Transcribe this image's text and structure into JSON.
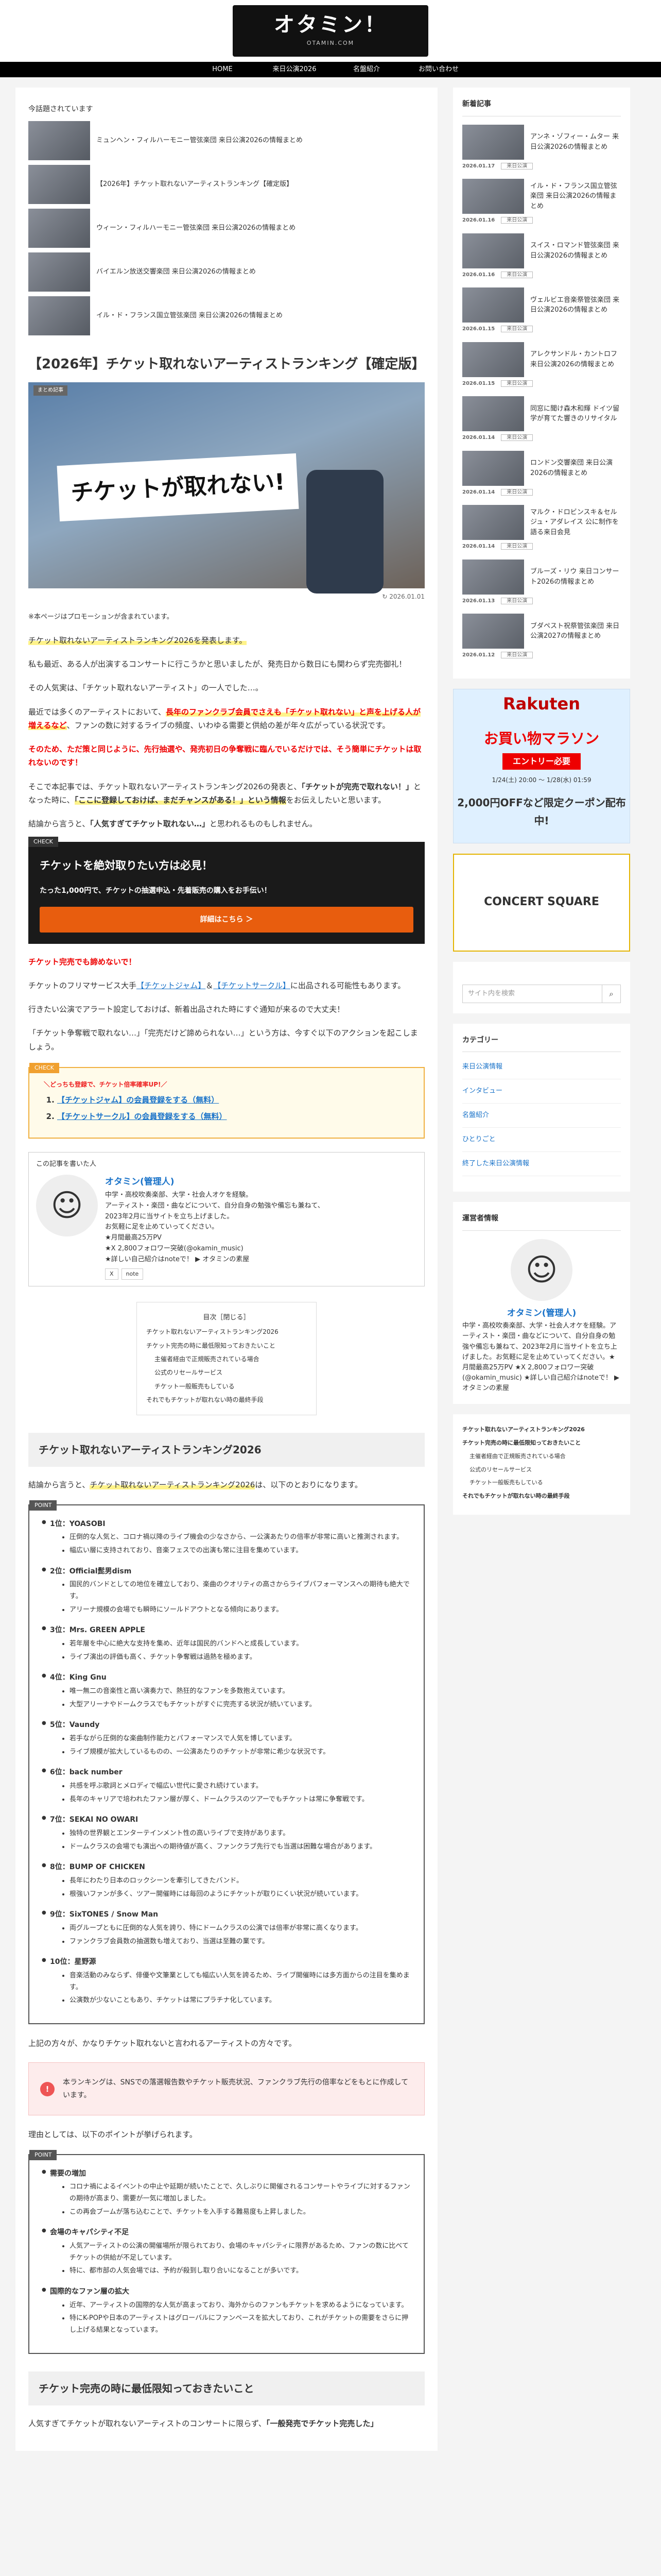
{
  "header": {
    "logo_title": "オタミン！",
    "logo_subtitle": "OTAMIN.COM"
  },
  "nav": [
    "HOME",
    "来日公演2026",
    "名盤紹介",
    "お問い合わせ"
  ],
  "recommend": {
    "label": "今話題されています",
    "items": [
      "ミュンヘン・フィルハーモニー管弦楽団 来日公演2026の情報まとめ",
      "【2026年】チケット取れないアーティストランキング【確定版】",
      "ウィーン・フィルハーモニー管弦楽団 来日公演2026の情報まとめ",
      "バイエルン放送交響楽団 来日公演2026の情報まとめ",
      "イル・ド・フランス国立管弦楽団 来日公演2026の情報まとめ"
    ]
  },
  "article": {
    "title": "【2026年】チケット取れないアーティストランキング【確定版】",
    "eyecatch_category": "まとめ記事",
    "eyecatch_text": "チケットが取れない!",
    "date": "2026.01.01",
    "pr_note": "※本ページはプロモーションが含まれています。",
    "p1": "チケット取れないアーティストランキング2026を発表します。",
    "p2": "私も最近、ある人が出演するコンサートに行こうかと思いましたが、発売日から数日にも関わらず完売御礼！",
    "p3": "その人気実は、「チケット取れないアーティスト」の一人でした…。",
    "p4a": "最近では多くのアーティストにおいて、",
    "p4b": "長年のファンクラブ会員でさえも「チケット取れない」と声を上げる人が増えるなど",
    "p4c": "、ファンの数に対するライブの頻度、いわゆる需要と供給の差が年々広がっている状況です。",
    "p5": "そのため、ただ策と同じように、先行抽選や、発売初日の争奪戦に臨んでいるだけでは、そう簡単にチケットは取れないのです！",
    "p6a": "そこで本記事では、チケット取れないアーティストランキング2026の発表と、",
    "p6b": "「チケットが完売で取れない！」",
    "p6c": "となった時に、",
    "p6d": "「ここに登録しておけば、まだチャンスがある！」という情報",
    "p6e": "をお伝えしたいと思います。",
    "p7a": "結論から言うと、",
    "p7b": "「人気すぎてチケット取れない…」",
    "p7c": "と思われるものもしれません。"
  },
  "cta": {
    "tag": "CHECK",
    "title": "チケットを絶対取りたい方は必見！",
    "sub": "たった1,000円で、チケットの抽選申込・先着販売の購入をお手伝い！",
    "button": "詳細はこちら ＞"
  },
  "p8": "チケット完売でも諦めないで！",
  "p9a": "チケットのフリマサービス大手",
  "p9b": "【チケットジャム】",
  "p9c": "＆",
  "p9d": "【チケットサークル】",
  "p9e": "に出品される可能性もあります。",
  "p10": "行きたい公演でアラート設定しておけば、新着出品された時にすぐ通知が来るので大丈夫！",
  "p11": "「チケット争奪戦で取れない…」「完売だけど諦められない…」という方は、今すぐ以下のアクションを起こしましょう。",
  "check": {
    "tag": "CHECK",
    "head": "＼どっちも登録で、チケット倍率確率UP!／",
    "items": [
      "【チケットジャム】の会員登録をする（無料）",
      "【チケットサークル】の会員登録をする（無料）"
    ]
  },
  "author": {
    "label": "この記事を書いた人",
    "name": "オタミン(管理人)",
    "lines": [
      "中学・高校吹奏楽部、大学・社会人オケを経験。",
      "アーティスト・楽団・曲などについて、自分自身の勉強や備忘も兼ねて、",
      "2023年2月に当サイトを立ち上げました。",
      "お気軽に足を止めていってください。",
      "★月間最高25万PV",
      "★X 2,800フォロワー突破(@okamin_music)",
      "★詳しい自己紹介はnoteで！ ▶ オタミンの素屋"
    ],
    "social": [
      "X",
      "note"
    ]
  },
  "toc": {
    "head": "目次［閉じる］",
    "items": [
      {
        "t": "チケット取れないアーティストランキング2026",
        "sub": false
      },
      {
        "t": "チケット完売の時に最低限知っておきたいこと",
        "sub": false
      },
      {
        "t": "主催者経由で正規販売されている場合",
        "sub": true
      },
      {
        "t": "公式のリセールサービス",
        "sub": true
      },
      {
        "t": "チケット一般販売もしている",
        "sub": true
      },
      {
        "t": "それでもチケットが取れない時の最終手段",
        "sub": false
      }
    ]
  },
  "h2_ranking": "チケット取れないアーティストランキング2026",
  "rank_intro_a": "結論から言うと、",
  "rank_intro_b": "チケット取れないアーティストランキング2026",
  "rank_intro_c": "は、以下のとおりになります。",
  "ranking": {
    "tag": "POINT",
    "items": [
      {
        "t": "1位：YOASOBI",
        "b": [
          "圧倒的な人気と、コロナ禍以降のライブ機会の少なさから、一公演あたりの倍率が非常に高いと推測されます。",
          "幅広い層に支持されており、音楽フェスでの出演も常に注目を集めています。"
        ]
      },
      {
        "t": "2位：Official髭男dism",
        "b": [
          "国民的バンドとしての地位を確立しており、楽曲のクオリティの高さからライブパフォーマンスへの期待も絶大です。",
          "アリーナ規模の会場でも瞬時にソールドアウトとなる傾向にあります。"
        ]
      },
      {
        "t": "3位：Mrs. GREEN APPLE",
        "b": [
          "若年層を中心に絶大な支持を集め、近年は国民的バンドへと成長しています。",
          "ライブ演出の評価も高く、チケット争奪戦は過熱を極めます。"
        ]
      },
      {
        "t": "4位：King Gnu",
        "b": [
          "唯一無二の音楽性と高い演奏力で、熱狂的なファンを多数抱えています。",
          "大型アリーナやドームクラスでもチケットがすぐに完売する状況が続いています。"
        ]
      },
      {
        "t": "5位：Vaundy",
        "b": [
          "若手ながら圧倒的な楽曲制作能力とパフォーマンスで人気を博しています。",
          "ライブ規模が拡大しているものの、一公演あたりのチケットが非常に希少な状況です。"
        ]
      },
      {
        "t": "6位：back number",
        "b": [
          "共感を呼ぶ歌詞とメロディで幅広い世代に愛され続けています。",
          "長年のキャリアで培われたファン層が厚く、ドームクラスのツアーでもチケットは常に争奪戦です。"
        ]
      },
      {
        "t": "7位：SEKAI NO OWARI",
        "b": [
          "独特の世界観とエンターテインメント性の高いライブで支持があります。",
          "ドームクラスの会場でも演出への期待値が高く、ファンクラブ先行でも当選は困難な場合があります。"
        ]
      },
      {
        "t": "8位：BUMP OF CHICKEN",
        "b": [
          "長年にわたり日本のロックシーンを牽引してきたバンド。",
          "根強いファンが多く、ツアー開催時には毎回のようにチケットが取りにくい状況が続いています。"
        ]
      },
      {
        "t": "9位：SixTONES / Snow Man",
        "b": [
          "両グループともに圧倒的な人気を誇り、特にドームクラスの公演では倍率が非常に高くなります。",
          "ファンクラブ会員数の抽選数も増えており、当選は至難の業です。"
        ]
      },
      {
        "t": "10位：星野源",
        "b": [
          "音楽活動のみならず、俳優や文筆業としても幅広い人気を誇るため、ライブ開催時には多方面からの注目を集めます。",
          "公演数が少ないこともあり、チケットは常にプラチナ化しています。"
        ]
      }
    ]
  },
  "after_rank": "上記の方々が、かなりチケット取れないと言われるアーティストの方々です。",
  "warn": "本ランキングは、SNSでの落選報告数やチケット販売状況、ファンクラブ先行の倍率などをもとに作成しています。",
  "reason_intro": "理由としては、以下のポイントが挙げられます。",
  "points": {
    "tag": "POINT",
    "items": [
      {
        "t": "需要の増加",
        "b": [
          "コロナ禍によるイベントの中止や延期が続いたことで、久しぶりに開催されるコンサートやライブに対するファンの期待が高まり、需要が一気に増加しました。",
          "この再会ブームが落ち込むことで、チケットを入手する難易度も上昇しました。"
        ]
      },
      {
        "t": "会場のキャパシティ不足",
        "b": [
          "人気アーティストの公演の開催場所が限られており、会場のキャパシティに限界があるため、ファンの数に比べてチケットの供給が不足しています。",
          "特に、都市部の人気会場では、予約が殺到し取り合いになることが多いです。"
        ]
      },
      {
        "t": "国際的なファン層の拡大",
        "b": [
          "近年、アーティストの国際的な人気が高まっており、海外からのファンもチケットを求めるようになっています。",
          "特にK-POPや日本のアーティストはグローバルにファンベースを拡大しており、これがチケットの需要をさらに押し上げる結果となっています。"
        ]
      }
    ]
  },
  "h2_tips": "チケット完売の時に最低限知っておきたいこと",
  "last_a": "人気すぎてチケットが取れないアーティストのコンサートに限らず、",
  "last_b": "「一般発売でチケット完売した」",
  "sidebar": {
    "new_head": "新着記事",
    "new_label": "来日公演",
    "new_items": [
      {
        "t": "アンネ・ゾフィー・ムター 来日公演2026の情報まとめ",
        "d": "2026.01.17"
      },
      {
        "t": "イル・ド・フランス国立管弦楽団 来日公演2026の情報まとめ",
        "d": "2026.01.16"
      },
      {
        "t": "スイス・ロマンド管弦楽団 来日公演2026の情報まとめ",
        "d": "2026.01.16"
      },
      {
        "t": "ヴェルビエ音楽祭管弦楽団 来日公演2026の情報まとめ",
        "d": "2026.01.15"
      },
      {
        "t": "アレクサンドル・カントロフ 来日公演2026の情報まとめ",
        "d": "2026.01.15"
      },
      {
        "t": "同窓に聞け森木和輝 ドイツ留学が育てた響きのリサイタル",
        "d": "2026.01.14"
      },
      {
        "t": "ロンドン交響楽団 来日公演2026の情報まとめ",
        "d": "2026.01.14"
      },
      {
        "t": "マルク・ドロビンスキ＆セルジュ・アダレイス 公に制作を語る来日会見",
        "d": "2026.01.14"
      },
      {
        "t": "ブルーズ・リウ 来日コンサート2026の情報まとめ",
        "d": "2026.01.13"
      },
      {
        "t": "ブダペスト祝祭管弦楽団 来日公演2027の情報まとめ",
        "d": "2026.01.12"
      }
    ],
    "ad_rakuten": {
      "brand": "Rakuten",
      "main": "お買い物マラソン",
      "btn": "エントリー必要",
      "date": "1/24(土) 20:00 ～ 1/28(水) 01:59",
      "extra": "2,000円OFFなど限定クーポン配布中!"
    },
    "ad_concert": "CONCERT SQUARE",
    "search_placeholder": "サイト内を検索",
    "cat_head": "カテゴリー",
    "cats": [
      {
        "n": "来日公演情報",
        "c": ""
      },
      {
        "n": "インタビュー",
        "c": ""
      },
      {
        "n": "名盤紹介",
        "c": ""
      },
      {
        "n": "ひとりごと",
        "c": ""
      },
      {
        "n": "終了した来日公演情報",
        "c": ""
      }
    ],
    "admin_head": "運営者情報",
    "admin_name": "オタミン(管理人)",
    "admin_text": "中学・高校吹奏楽部、大学・社会人オケを経験。アーティスト・楽団・曲などについて、自分自身の勉強や備忘も兼ねて、2023年2月に当サイトを立ち上げました。お気軽に足を止めていってください。★月間最高25万PV ★X 2,800フォロワー突破(@okamin_music) ★詳しい自己紹介はnoteで！ ▶ オタミンの素屋",
    "toc": [
      {
        "t": "チケット取れないアーティストランキング2026",
        "s": 0
      },
      {
        "t": "チケット完売の時に最低限知っておきたいこと",
        "s": 0
      },
      {
        "t": "主催者経由で正規販売されている場合",
        "s": 1
      },
      {
        "t": "公式のリセールサービス",
        "s": 1
      },
      {
        "t": "チケット一般販売もしている",
        "s": 1
      },
      {
        "t": "それでもチケットが取れない時の最終手段",
        "s": 0
      }
    ]
  }
}
